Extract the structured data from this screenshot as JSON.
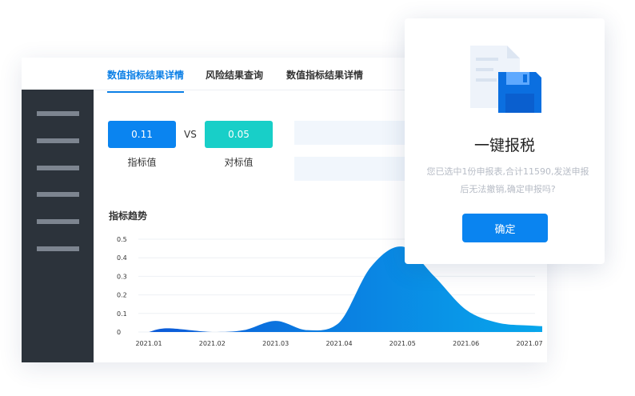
{
  "tabs": [
    "数值指标结果详情",
    "风险结果查询",
    "数值指标结果详情"
  ],
  "metrics": {
    "indicator": {
      "value": "0.11",
      "label": "指标值",
      "color": "#0a84f0"
    },
    "vs": "VS",
    "benchmark": {
      "value": "0.05",
      "label": "对标值",
      "color": "#18cfc8"
    }
  },
  "chart_data": {
    "type": "area",
    "title": "指标趋势",
    "x": [
      "2021.01",
      "2021.02",
      "2021.03",
      "2021.04",
      "2021.05",
      "2021.06",
      "2021.07"
    ],
    "y_ticks": [
      "0",
      "0.1",
      "0.2",
      "0.3",
      "0.4",
      "0.5"
    ],
    "ylim": [
      0,
      0.5
    ],
    "series": [
      {
        "points": [
          [
            0.0,
            0.0
          ],
          [
            0.3,
            0.02
          ],
          [
            1.0,
            0.0
          ],
          [
            1.5,
            0.01
          ],
          [
            2.0,
            0.06
          ],
          [
            2.5,
            0.01
          ],
          [
            3.0,
            0.05
          ],
          [
            3.5,
            0.35
          ],
          [
            4.0,
            0.46
          ],
          [
            4.5,
            0.3
          ],
          [
            5.0,
            0.12
          ],
          [
            5.5,
            0.05
          ],
          [
            6.0,
            0.035
          ],
          [
            6.3,
            0.03
          ]
        ],
        "color_start": "#0c5ad8",
        "color_end": "#08a8ec"
      }
    ],
    "grid": true
  },
  "dialog": {
    "title": "一键报税",
    "message": "您已选中1份申报表,合计11590,发送申报后无法撤销,确定申报吗?",
    "confirm_label": "确定",
    "icon": "save-document-icon"
  }
}
